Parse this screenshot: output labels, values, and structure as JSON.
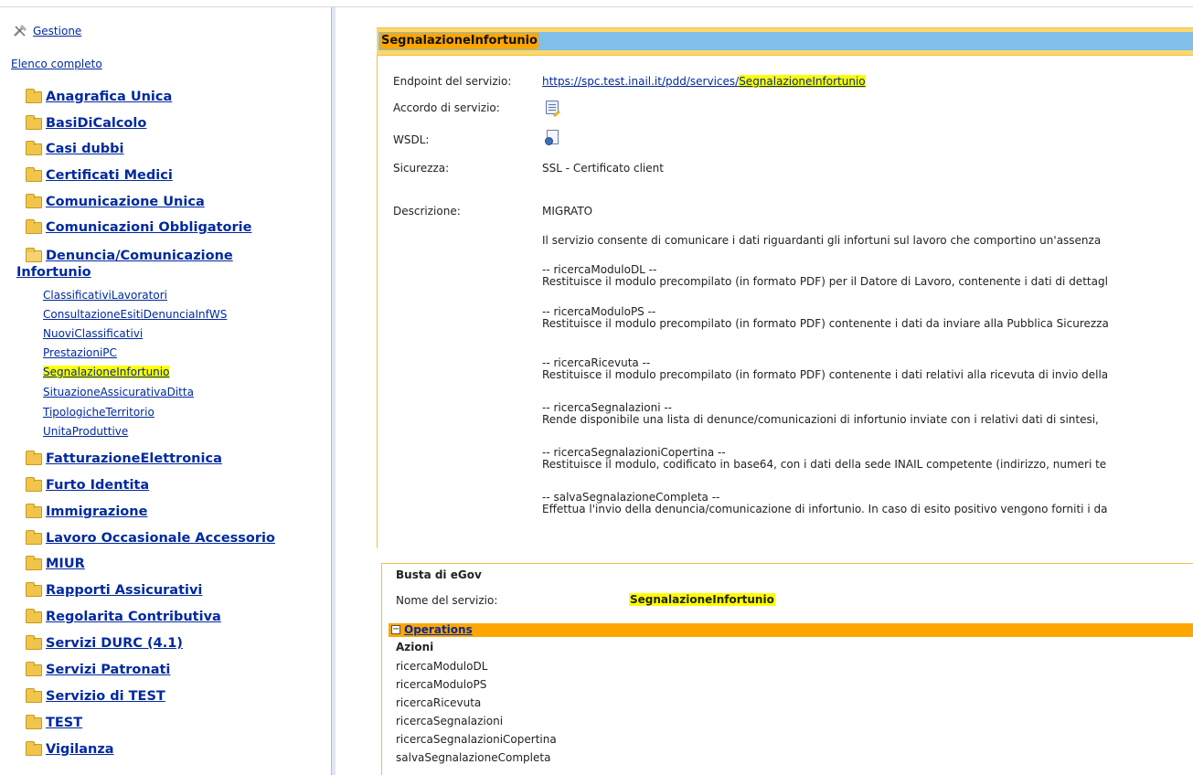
{
  "sidebar": {
    "gestione": "Gestione",
    "elenco": "Elenco completo",
    "categories": [
      "Anagrafica Unica",
      "BasiDiCalcolo",
      "Casi dubbi",
      "Certificati Medici",
      "Comunicazione Unica",
      "Comunicazioni Obbligatorie",
      "Denuncia/Comunicazione",
      "Infortunio",
      "FatturazioneElettronica",
      "Furto Identita",
      "Immigrazione",
      "Lavoro Occasionale Accessorio",
      "MIUR",
      "Rapporti Assicurativi",
      "Regolarita Contributiva",
      "Servizi DURC (4.1)",
      "Servizi Patronati",
      "Servizio di TEST",
      "TEST",
      "Vigilanza"
    ],
    "subitems": [
      "ClassificativiLavoratori",
      "ConsultazioneEsitiDenunciaInfWS",
      "NuoviClassificativi",
      "PrestazioniPC",
      "SegnalazioneInfortunio",
      "SituazioneAssicurativaDitta",
      "TipologicheTerritorio",
      "UnitaProduttive"
    ]
  },
  "service": {
    "title": "SegnalazioneInfortunio",
    "endpoint_label": "Endpoint del servizio:",
    "endpoint_prefix": "https://spc.test.inail.it/pdd/services/",
    "endpoint_highlight": "SegnalazioneInfortunio",
    "accordo_label": "Accordo di servizio:",
    "wsdl_label": "WSDL:",
    "sicurezza_label": "Sicurezza:",
    "sicurezza_value": "SSL - Certificato client",
    "descrizione_label": "Descrizione:",
    "descrizione": [
      "MIGRATO",
      "Il servizio consente di comunicare i dati riguardanti gli infortuni sul lavoro che comportino un'assenza",
      "-- ricercaModuloDL --",
      "Restituisce il modulo precompilato (in formato PDF) per il Datore di Lavoro, contenente i dati di dettagl",
      "-- ricercaModuloPS --",
      "Restituisce il modulo precompilato (in formato PDF) contenente i dati da inviare alla Pubblica Sicurezza",
      "-- ricercaRicevuta --",
      "Restituisce il modulo precompilato (in formato PDF) contenente i dati relativi alla ricevuta di invio della",
      "-- ricercaSegnalazioni --",
      "Rende disponibile una lista di denunce/comunicazioni di infortunio inviate con i relativi dati di sintesi,",
      "-- ricercaSegnalazioniCopertina --",
      "Restituisce il modulo, codificato in base64, con i dati della sede INAIL competente (indirizzo, numeri te",
      "-- salvaSegnalazioneCompleta --",
      "Effettua l'invio della denuncia/comunicazione di infortunio. In caso di esito positivo vengono forniti i da"
    ]
  },
  "busta": {
    "title": "Busta di eGov",
    "nome_label": "Nome del servizio:",
    "nome_value": "SegnalazioneInfortunio",
    "operations_label": "Operations",
    "operations_toggle": "−",
    "azioni_label": "Azioni",
    "operations": [
      "ricercaModuloDL",
      "ricercaModuloPS",
      "ricercaRicevuta",
      "ricercaSegnalazioni",
      "ricercaSegnalazioniCopertina",
      "salvaSegnalazioneCompleta"
    ]
  }
}
